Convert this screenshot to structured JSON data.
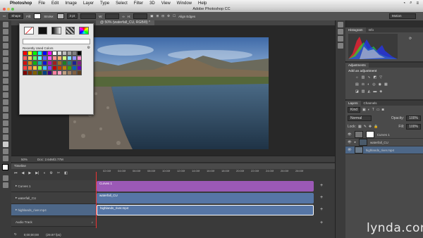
{
  "menubar": {
    "app": "Photoshop",
    "items": [
      "File",
      "Edit",
      "Image",
      "Layer",
      "Type",
      "Select",
      "Filter",
      "3D",
      "View",
      "Window",
      "Help"
    ]
  },
  "window": {
    "title": "Adobe Photoshop CC"
  },
  "options": {
    "mode": "Shape",
    "fill_label": "Fill:",
    "stroke_label": "Stroke:",
    "stroke_size": "3 pt",
    "w_label": "W:",
    "h_label": "H:",
    "align_edges": "Align Edges",
    "workspace": "Motion"
  },
  "document": {
    "tab": "@ 50% (waterfall_CU, RGB/8) *",
    "zoom": "50%",
    "doc_size": "Doc: 2.64M/2.77M"
  },
  "picker": {
    "recent_label": "Recently Used Colors",
    "swatch_colors": [
      "#ff0000",
      "#ffff00",
      "#00ff00",
      "#00ffff",
      "#0000ff",
      "#ff00ff",
      "#ffffff",
      "#e0e0e0",
      "#c0c0c0",
      "#a0a0a0",
      "#808080",
      "#000000",
      "#ff6060",
      "#ffd060",
      "#60ff60",
      "#60ffff",
      "#6060ff",
      "#ff60ff",
      "#ff9090",
      "#ffb070",
      "#d0ff80",
      "#80e0ff",
      "#9090ff",
      "#ff90d0",
      "#d01010",
      "#d09010",
      "#10b010",
      "#10b0b0",
      "#1010d0",
      "#b010b0",
      "#a02020",
      "#a07020",
      "#208020",
      "#208080",
      "#202090",
      "#802080",
      "#ff4040",
      "#ff8040",
      "#ffc040",
      "#80ff40",
      "#40c0ff",
      "#8040ff",
      "#c00000",
      "#c04000",
      "#c08000",
      "#40a000",
      "#0060c0",
      "#6000c0",
      "#800000",
      "#803000",
      "#806000",
      "#306000",
      "#004080",
      "#400080",
      "#ff80a0",
      "#ffa0c0",
      "#c0a080",
      "#a08060",
      "#806040",
      "#604020"
    ]
  },
  "timeline": {
    "title": "Timeline",
    "timecode": "0;00;00;00",
    "fps": "(29.97 fps)",
    "ruler": [
      "02:00f",
      "04:00f",
      "06:00f",
      "08:00f",
      "10:00f",
      "12:00f",
      "14:00f",
      "16:00f",
      "18:00f",
      "20:00f",
      "22:00f",
      "24:00f",
      "26:00f",
      "28:00f"
    ],
    "tracks": [
      {
        "name": "Curves 1",
        "clip": "Curves 1",
        "color": "#9b59b6"
      },
      {
        "name": "waterfall_CU",
        "clip": "waterfall_CU",
        "color": "#5676a6"
      },
      {
        "name": "highlands_river.mp4",
        "clip": "highlands_river.mp4",
        "color": "#5676a6"
      }
    ],
    "audio_track": "Audio Track"
  },
  "panels": {
    "histogram_tabs": [
      "Histogram",
      "Info"
    ],
    "adjustments_tab": "Adjustments",
    "add_adjustment": "Add an adjustment",
    "layers_tabs": [
      "Layers",
      "Channels"
    ],
    "kind": "Kind",
    "blend": "Normal",
    "opacity_label": "Opacity:",
    "opacity": "100%",
    "lock_label": "Lock:",
    "fill_label": "Fill:",
    "fill": "100%",
    "layers": [
      {
        "name": "Curves 1"
      },
      {
        "name": "waterfall_CU"
      },
      {
        "name": "highlands_river.mp4"
      }
    ]
  },
  "watermark": "lynda.com"
}
